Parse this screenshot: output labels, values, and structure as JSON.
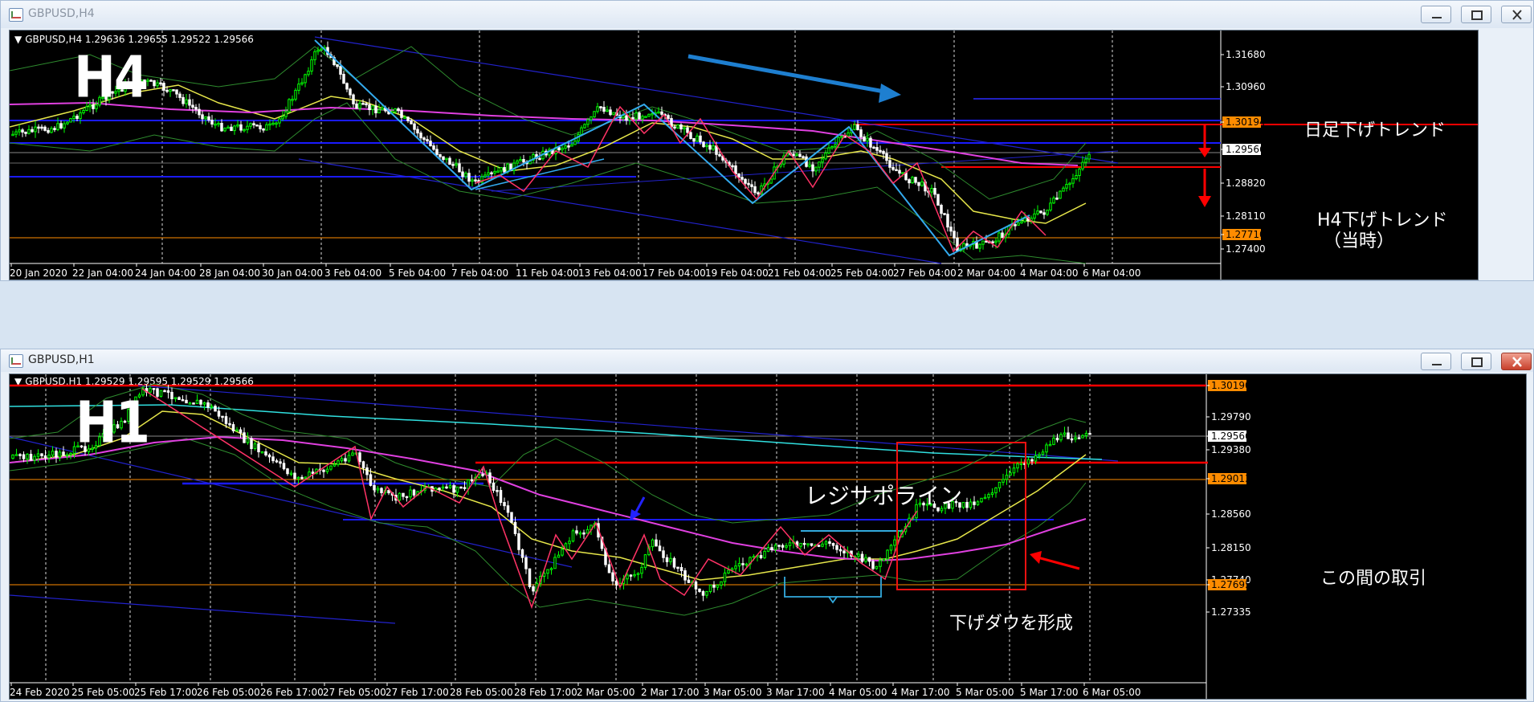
{
  "top_window": {
    "title": "GBPUSD,H4",
    "symbol_line": "GBPUSD,H4  1.29636 1.29655 1.29522 1.29566",
    "big_label": "H4",
    "annotations": {
      "daily_down": "日足下げトレンド",
      "h4_down_1": "H4下げトレンド",
      "h4_down_2": "（当時）"
    },
    "price_labels": [
      "1.31680",
      "1.30960",
      "1.30194",
      "1.29566",
      "1.28820",
      "1.28110",
      "1.27710",
      "1.27400"
    ],
    "time_labels": [
      "20 Jan 2020",
      "22 Jan 04:00",
      "24 Jan 04:00",
      "28 Jan 04:00",
      "30 Jan 04:00",
      "3 Feb 04:00",
      "5 Feb 04:00",
      "7 Feb 04:00",
      "11 Feb 04:00",
      "13 Feb 04:00",
      "17 Feb 04:00",
      "19 Feb 04:00",
      "21 Feb 04:00",
      "25 Feb 04:00",
      "27 Feb 04:00",
      "2 Mar 04:00",
      "4 Mar 04:00",
      "6 Mar 04:00"
    ]
  },
  "bottom_window": {
    "title": "GBPUSD,H1",
    "symbol_line": "GBPUSD,H1  1.29529 1.29595 1.29529 1.29566",
    "big_label": "H1",
    "annotations": {
      "resisup": "レジサポライン",
      "downtrend": "下げダウを形成",
      "trade": "この間の取引"
    },
    "price_labels": [
      "1.30190",
      "1.29790",
      "1.29566",
      "1.29380",
      "1.29013",
      "1.28560",
      "1.28150",
      "1.27740",
      "1.27695",
      "1.27335"
    ],
    "time_labels": [
      "24 Feb 2020",
      "25 Feb 05:00",
      "25 Feb 17:00",
      "26 Feb 05:00",
      "26 Feb 17:00",
      "27 Feb 05:00",
      "27 Feb 17:00",
      "28 Feb 05:00",
      "28 Feb 17:00",
      "2 Mar 05:00",
      "2 Mar 17:00",
      "3 Mar 05:00",
      "3 Mar 17:00",
      "4 Mar 05:00",
      "4 Mar 17:00",
      "5 Mar 05:00",
      "5 Mar 17:00",
      "6 Mar 05:00"
    ]
  },
  "colors": {
    "candle_up": "#00ff00",
    "candle_down": "#ffffff",
    "ma_yellow": "#e6e64a",
    "ma_magenta": "#e040e0",
    "bollinger": "#2e8b2e",
    "zigzag_h4": "#33aaee",
    "zigzag_h1": "#ff3366",
    "hline_blue": "#1a1aff",
    "hline_red": "#ff0000",
    "hline_orange": "#ff8c00",
    "arrow_blue": "#1e7fd0"
  }
}
